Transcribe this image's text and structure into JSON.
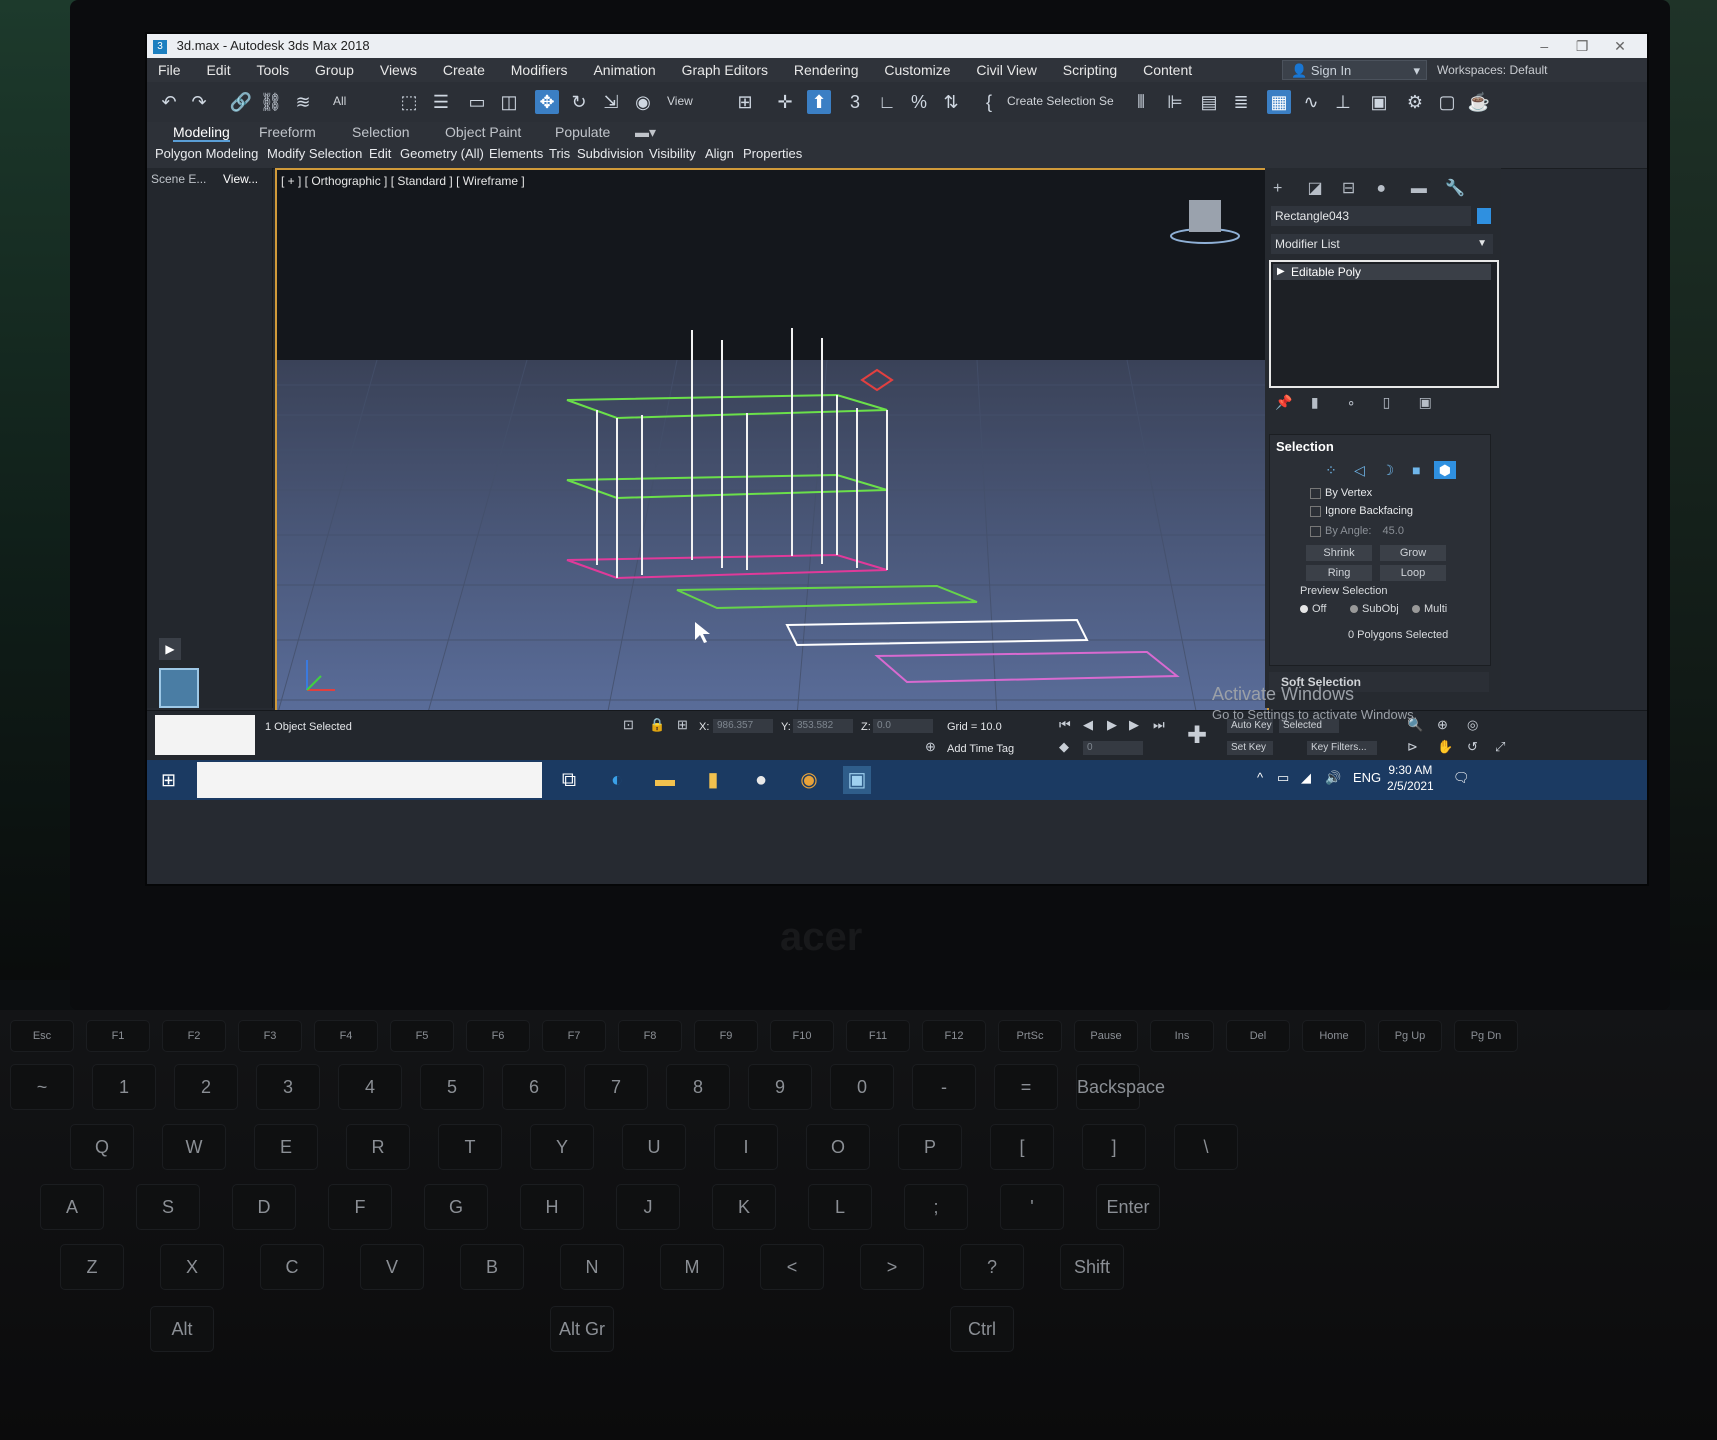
{
  "window": {
    "title": "3d.max - Autodesk 3ds Max 2018",
    "app_icon": "3"
  },
  "menu": [
    "File",
    "Edit",
    "Tools",
    "Group",
    "Views",
    "Create",
    "Modifiers",
    "Animation",
    "Graph Editors",
    "Rendering",
    "Customize",
    "Civil View",
    "Scripting",
    "Content"
  ],
  "signin": "Sign In",
  "workspaces": "Workspaces:  Default",
  "toolbar": {
    "filter": "All",
    "refcoord": "View",
    "named_selection": "Create Selection Se"
  },
  "ribbon": {
    "tabs": [
      "Modeling",
      "Freeform",
      "Selection",
      "Object Paint",
      "Populate"
    ],
    "subtabs": [
      "Polygon Modeling",
      "Modify Selection",
      "Edit",
      "Geometry (All)",
      "Elements",
      "Tris",
      "Subdivision",
      "Visibility",
      "Align",
      "Properties"
    ]
  },
  "scene_explorer": {
    "tab1": "Scene E...",
    "tab2": "View..."
  },
  "viewport": {
    "label": "[ + ] [ Orthographic ] [ Standard ] [ Wireframe ]"
  },
  "command_panel": {
    "object_name": "Rectangle043",
    "modifier_list": "Modifier List",
    "stack_item": "Editable Poly",
    "selection": {
      "title": "Selection",
      "by_vertex": "By Vertex",
      "ignore_backfacing": "Ignore Backfacing",
      "by_angle": "By Angle:",
      "angle_value": "45.0",
      "shrink": "Shrink",
      "grow": "Grow",
      "ring": "Ring",
      "loop": "Loop",
      "preview": "Preview Selection",
      "off": "Off",
      "subobj": "SubObj",
      "multi": "Multi",
      "count": "0 Polygons Selected"
    },
    "soft_selection": "Soft Selection"
  },
  "watermark": {
    "line1": "Activate Windows",
    "line2": "Go to Settings to activate Windows."
  },
  "status": {
    "selected": "1 Object Selected",
    "x_label": "X:",
    "x": "986.357",
    "y_label": "Y:",
    "y": "353.582",
    "z_label": "Z:",
    "z": "0.0",
    "grid": "Grid = 10.0",
    "add_time_tag": "Add Time Tag",
    "auto_key": "Auto Key",
    "selected_set": "Selected",
    "set_key": "Set Key",
    "key_filters": "Key Filters...",
    "frame": "0"
  },
  "taskbar": {
    "lang": "ENG",
    "time": "9:30 AM",
    "date": "2/5/2021"
  },
  "brand": "acer",
  "keyboard": {
    "fkeys": [
      "Esc",
      "F1",
      "F2",
      "F3",
      "F4",
      "F5",
      "F6",
      "F7",
      "F8",
      "F9",
      "F10",
      "F11",
      "F12",
      "PrtSc",
      "Pause",
      "Ins",
      "Del",
      "Home",
      "Pg Up",
      "Pg Dn"
    ],
    "row1": [
      "~",
      "1",
      "2",
      "3",
      "4",
      "5",
      "6",
      "7",
      "8",
      "9",
      "0",
      "-",
      "=",
      "Backspace"
    ],
    "row2": [
      "Q",
      "W",
      "E",
      "R",
      "T",
      "Y",
      "U",
      "I",
      "O",
      "P",
      "[",
      "]",
      "\\"
    ],
    "row3": [
      "A",
      "S",
      "D",
      "F",
      "G",
      "H",
      "J",
      "K",
      "L",
      ";",
      "'",
      "Enter"
    ],
    "row4": [
      "Z",
      "X",
      "C",
      "V",
      "B",
      "N",
      "M",
      "<",
      ">",
      "?",
      "Shift"
    ],
    "row5": [
      "Alt",
      "Alt Gr",
      "Ctrl"
    ]
  }
}
